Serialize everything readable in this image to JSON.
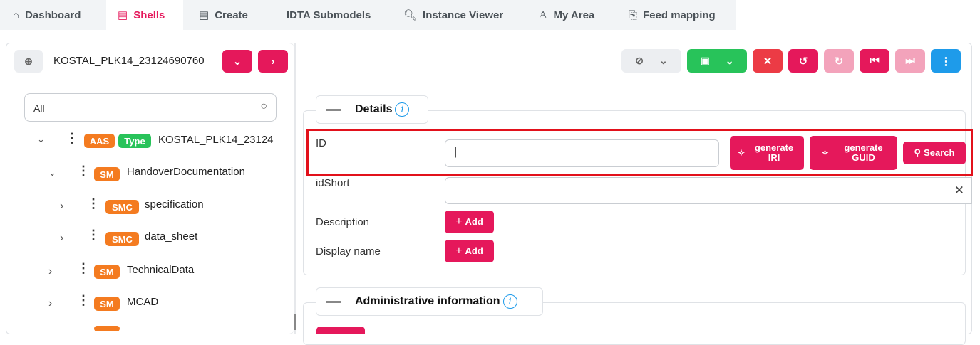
{
  "nav": {
    "tabs": [
      {
        "label": "Dashboard",
        "icon": "home-icon"
      },
      {
        "label": "Shells",
        "icon": "document-icon",
        "active": true
      },
      {
        "label": "Create",
        "icon": "form-icon"
      },
      {
        "label": "IDTA Submodels"
      },
      {
        "label": "Instance Viewer",
        "icon": "magnify-icon"
      },
      {
        "label": "My Area",
        "icon": "user-icon"
      },
      {
        "label": "Feed mapping",
        "icon": "feed-icon"
      }
    ]
  },
  "left": {
    "shell_id": "KOSTAL_PLK14_23124690760",
    "filter_value": "All",
    "tree": [
      {
        "badges": [
          "AAS",
          "Type"
        ],
        "label": "KOSTAL_PLK14_23124"
      },
      {
        "badges": [
          "SM"
        ],
        "label": "HandoverDocumentation"
      },
      {
        "badges": [
          "SMC"
        ],
        "label": "specification"
      },
      {
        "badges": [
          "SMC"
        ],
        "label": "data_sheet"
      },
      {
        "badges": [
          "SM"
        ],
        "label": "TechnicalData"
      },
      {
        "badges": [
          "SM"
        ],
        "label": "MCAD"
      }
    ]
  },
  "details": {
    "title": "Details",
    "id_label": "ID",
    "id_value": "",
    "generate_iri": "generate IRI",
    "generate_guid": "generate GUID",
    "search_label": "Search",
    "idshort_label": "idShort",
    "description_label": "Description",
    "display_name_label": "Display name",
    "add_label": "Add"
  },
  "admin": {
    "title": "Administrative information"
  },
  "colors": {
    "accent": "#e5185b",
    "highlight": "#e2111b",
    "green": "#28c35a",
    "orange": "#f47b20",
    "blue": "#1e9bea"
  }
}
